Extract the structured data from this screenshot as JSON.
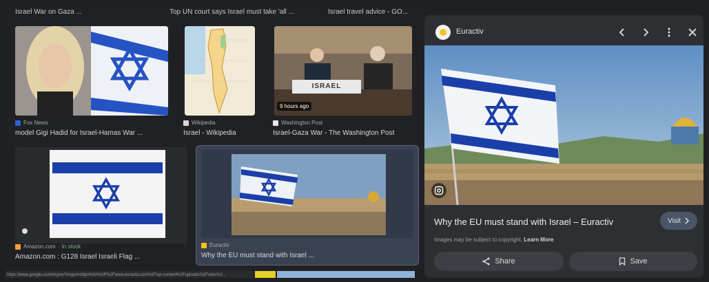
{
  "top_captions": [
    "Israel War on Gaza ...",
    "Top UN court says Israel must take 'all ...",
    "Israel travel advice - GO..."
  ],
  "results": [
    {
      "source": "Fox News",
      "title": "model Gigi Hadid for Israel-Hamas War ..."
    },
    {
      "source": "Wikipedia",
      "title": "Israel - Wikipedia"
    },
    {
      "source": "Washington Post",
      "title": "Israel-Gaza War - The Washington Post",
      "badge": "9 hours ago",
      "placard": "ISRAEL"
    },
    {
      "source": "Amazon.com",
      "stock": "· In stock",
      "title": "Amazon.com : G128 Israel Israeli Flag ..."
    },
    {
      "source": "Euractiv",
      "title": "Why the EU must stand with Israel ..."
    }
  ],
  "panel": {
    "site": "Euractiv",
    "title": "Why the EU must stand with Israel – Euractiv",
    "visit_label": "Visit",
    "copyright": "Images may be subject to copyright.",
    "learn_more": "Learn More",
    "share_label": "Share",
    "save_label": "Save"
  },
  "status_url": "https://www.google.com/imgres?imgurl=https%3A%2F%2Fwww.euractiv.com%2Fwp-content%2Fuploads%2Fsites%2...",
  "icons": {
    "prev": "chevron-left-icon",
    "next": "chevron-right-icon",
    "more": "more-vert-icon",
    "close": "close-icon",
    "lens": "lens-icon",
    "share": "share-icon",
    "save": "bookmark-icon",
    "visit": "chevron-right-icon"
  },
  "colors": {
    "background": "#202124",
    "panel": "#2d2f33",
    "flag_blue": "#1a3fa8",
    "selected": "#3a4252"
  }
}
